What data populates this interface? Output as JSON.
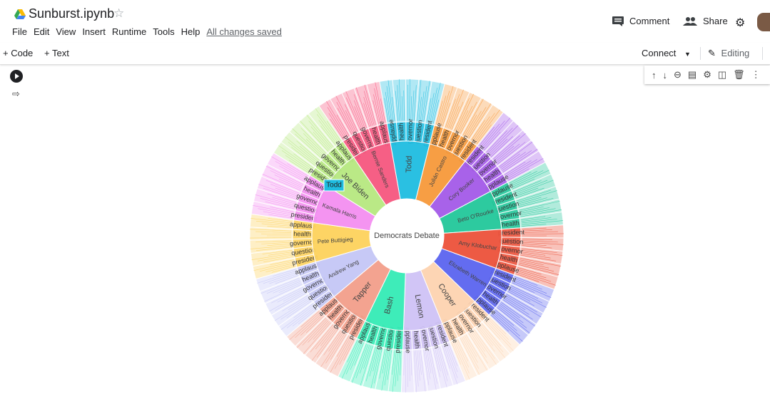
{
  "header": {
    "title": "Sunburst.ipynb",
    "star": "☆",
    "menu": [
      "File",
      "Edit",
      "View",
      "Insert",
      "Runtime",
      "Tools",
      "Help"
    ],
    "saved": "All changes saved",
    "comment_label": "Comment",
    "share_label": "Share"
  },
  "toolbar": {
    "code_label": "+ Code",
    "text_label": "+ Text",
    "connect_label": "Connect",
    "editing_label": "Editing"
  },
  "chart_data": {
    "type": "sunburst",
    "root": "Democrats Debate",
    "tooltip": "Todd",
    "nodes": [
      {
        "name": "Todd",
        "color": "#1fbde0",
        "leaves": [
          "applause",
          "health",
          "governor",
          "question",
          "president"
        ]
      },
      {
        "name": "Julián Castro",
        "color": "#f7993a",
        "leaves": [
          "applause",
          "health",
          "governor",
          "question",
          "president"
        ]
      },
      {
        "name": "Cory Booker",
        "color": "#a35ae8",
        "leaves": [
          "president",
          "question",
          "governor",
          "health",
          "applause"
        ]
      },
      {
        "name": "Beto O'Rourke",
        "color": "#22c79a",
        "leaves": [
          "applause",
          "president",
          "question",
          "governor",
          "health"
        ]
      },
      {
        "name": "Amy Klobuchar",
        "color": "#ec513a",
        "leaves": [
          "president",
          "question",
          "governor",
          "health",
          "applause"
        ]
      },
      {
        "name": "Elizabeth Warren",
        "color": "#5b64ef",
        "leaves": [
          "president",
          "question",
          "governor",
          "health",
          "applause"
        ]
      },
      {
        "name": "Cooper",
        "color": "#fdd3b0",
        "leaves": [
          "president",
          "question",
          "governor",
          "health",
          "applause"
        ]
      },
      {
        "name": "Lemon",
        "color": "#cfc2f5",
        "leaves": [
          "president",
          "question",
          "governor",
          "health",
          "applause"
        ]
      },
      {
        "name": "Bash",
        "color": "#34ebb5",
        "leaves": [
          "president",
          "question",
          "governor",
          "health",
          "applause"
        ]
      },
      {
        "name": "Tapper",
        "color": "#f29e8a",
        "leaves": [
          "president",
          "question",
          "governor",
          "health",
          "applause"
        ]
      },
      {
        "name": "Andrew Yang",
        "color": "#c4c6f5",
        "leaves": [
          "president",
          "question",
          "governor",
          "health",
          "applause"
        ]
      },
      {
        "name": "Pete Buttigieg",
        "color": "#fdd25c",
        "leaves": [
          "president",
          "question",
          "governor",
          "health",
          "applause"
        ]
      },
      {
        "name": "Kamala Harris",
        "color": "#f38ef0",
        "leaves": [
          "president",
          "question",
          "governor",
          "health",
          "applause"
        ]
      },
      {
        "name": "Joe Biden",
        "color": "#b6e880",
        "leaves": [
          "president",
          "question",
          "governor",
          "health",
          "applause"
        ]
      },
      {
        "name": "Bernie Sanders",
        "color": "#f6567e",
        "leaves": [
          "president",
          "question",
          "governor",
          "health",
          "applause"
        ]
      }
    ]
  }
}
